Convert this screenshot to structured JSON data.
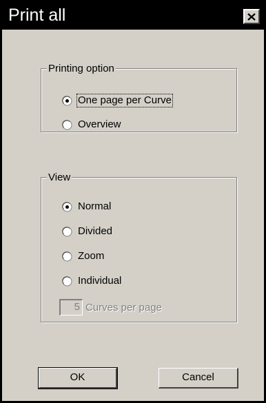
{
  "window": {
    "title": "Print all"
  },
  "printing_option": {
    "legend": "Printing option",
    "options": [
      {
        "label": "One page per Curve",
        "selected": true
      },
      {
        "label": "Overview",
        "selected": false
      }
    ]
  },
  "view": {
    "legend": "View",
    "options": [
      {
        "label": "Normal",
        "selected": true
      },
      {
        "label": "Divided",
        "selected": false
      },
      {
        "label": "Zoom",
        "selected": false
      },
      {
        "label": "Individual",
        "selected": false
      }
    ],
    "curves_per_page": {
      "value": "5",
      "label": "Curves per page",
      "enabled": false
    }
  },
  "buttons": {
    "ok": "OK",
    "cancel": "Cancel"
  },
  "colors": {
    "dialog_face": "#d4d0c8",
    "title_bar": "#000000",
    "disabled_text": "#808080"
  }
}
